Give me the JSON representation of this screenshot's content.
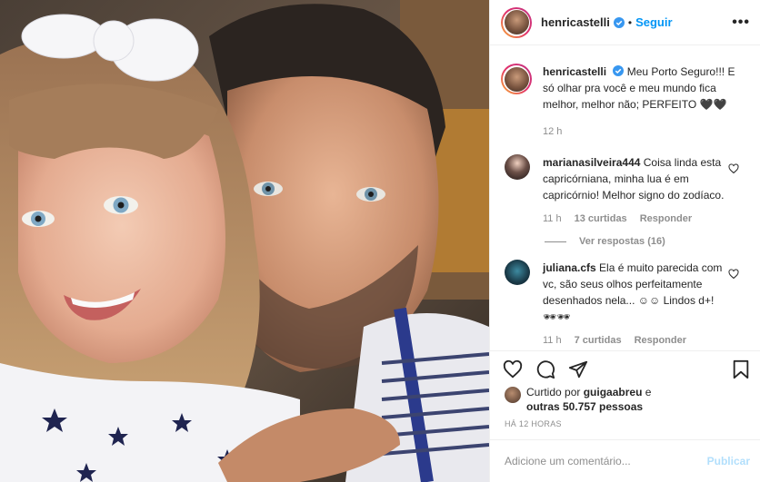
{
  "post": {
    "username": "henricastelli",
    "follow_label": "Seguir",
    "dot": "•",
    "more": "•••"
  },
  "caption": {
    "username": "henricastelli",
    "text": "Meu Porto Seguro!!! E só olhar pra você e meu mundo fica melhor, melhor não; PERFEITO 🖤🖤",
    "time": "12 h"
  },
  "comments": [
    {
      "username": "marianasilveira444",
      "text": "Coisa linda esta capricórniana, minha lua é em capricórnio! Melhor signo do zodíaco.",
      "time": "11 h",
      "likes": "13 curtidas",
      "reply": "Responder",
      "view_replies": "Ver respostas (16)"
    },
    {
      "username": "juliana.cfs",
      "text": "Ela é muito parecida com vc, são seus olhos perfeitamente desenhados nela... ☺☺ Lindos d+! 🕶🕶",
      "time": "11 h",
      "likes": "7 curtidas",
      "reply": "Responder"
    }
  ],
  "likes": {
    "prefix": "Curtido por",
    "user": "guigaabreu",
    "connector": "e",
    "others": "outras 50.757 pessoas"
  },
  "timestamp": "HÁ 12 HORAS",
  "add_comment": {
    "placeholder": "Adicione um comentário...",
    "publish": "Publicar"
  },
  "colors": {
    "accent": "#0095f6",
    "muted": "#8e8e8e",
    "publish_disabled": "#b2dffc"
  }
}
